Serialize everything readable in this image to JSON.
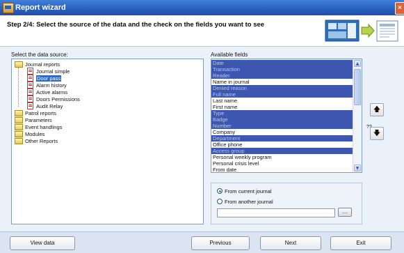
{
  "window": {
    "title": "Report wizard",
    "close_glyph": "×"
  },
  "header": {
    "step_text": "Step 2/4: Select the source of the data and the check on the fields you want to see"
  },
  "data_source": {
    "label": "Select the data source:",
    "tree": [
      {
        "label": "Journal reports",
        "icon": "folder-icon",
        "level": 0
      },
      {
        "label": "Journal simple",
        "icon": "report-icon",
        "level": 1
      },
      {
        "label": "Door pass",
        "icon": "report-icon",
        "level": 1,
        "selected": true
      },
      {
        "label": "Alarm history",
        "icon": "report-icon",
        "level": 1
      },
      {
        "label": "Active alarms",
        "icon": "report-icon",
        "level": 1
      },
      {
        "label": "Doors Permissions",
        "icon": "report-icon",
        "level": 1
      },
      {
        "label": "Audit Relay",
        "icon": "report-icon",
        "level": 1
      },
      {
        "label": "Patrol reports",
        "icon": "folder-icon",
        "level": 0
      },
      {
        "label": "Parameters",
        "icon": "folder-icon",
        "level": 0
      },
      {
        "label": "Event handlings",
        "icon": "folder-icon",
        "level": 0
      },
      {
        "label": "Modules",
        "icon": "folder-icon",
        "level": 0
      },
      {
        "label": "Other Reports",
        "icon": "folder-icon",
        "level": 0
      }
    ]
  },
  "fields": {
    "label": "Available fields",
    "items": [
      {
        "label": "Date",
        "selected": true
      },
      {
        "label": "Transaction",
        "selected": true
      },
      {
        "label": "Reader",
        "selected": true
      },
      {
        "label": "Name in journal",
        "selected": false
      },
      {
        "label": "Denied reason",
        "selected": true
      },
      {
        "label": "Full name",
        "selected": true
      },
      {
        "label": "Last name",
        "selected": false
      },
      {
        "label": "First name",
        "selected": false
      },
      {
        "label": "Type",
        "selected": true
      },
      {
        "label": "Badge",
        "selected": true
      },
      {
        "label": "Number",
        "selected": true
      },
      {
        "label": "Company",
        "selected": false
      },
      {
        "label": "Department",
        "selected": true
      },
      {
        "label": "Office phone",
        "selected": false
      },
      {
        "label": "Access group",
        "selected": true
      },
      {
        "label": "Personal weekly program",
        "selected": false
      },
      {
        "label": "Personal crisis level",
        "selected": false
      },
      {
        "label": "From date",
        "selected": false
      }
    ],
    "move_up": "🡅",
    "move_down": "🡇",
    "mystery_text": "??"
  },
  "journal": {
    "option_current": "From current journal",
    "option_other": "From another journal",
    "selected": "current",
    "path_value": "",
    "browse_label": "..."
  },
  "footer": {
    "view_data": "View data",
    "previous": "Previous",
    "next": "Next",
    "exit": "Exit"
  },
  "colors": {
    "titlebar": "#2a5fbe",
    "selection": "#3d57b0",
    "header_bg": "#ffffff"
  }
}
